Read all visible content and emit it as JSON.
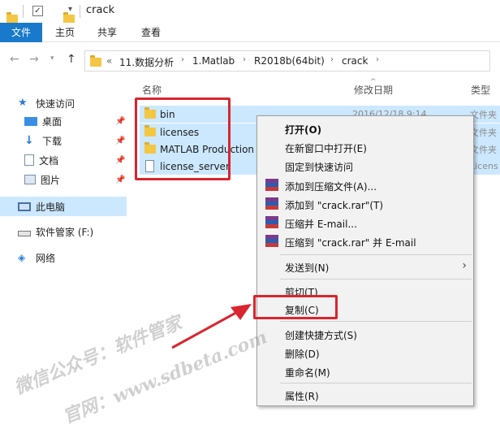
{
  "window": {
    "title": "crack"
  },
  "ribbon": {
    "tabs": [
      "文件",
      "主页",
      "共享",
      "查看"
    ]
  },
  "address": {
    "overflow": "«",
    "segments": [
      "11.数据分析",
      "1.Matlab",
      "R2018b(64bit)",
      "crack"
    ]
  },
  "navpane": {
    "quick_access": "快速访问",
    "items": [
      "桌面",
      "下载",
      "文档",
      "图片"
    ],
    "this_pc": "此电脑",
    "drive": "软件管家 (F:)",
    "network": "网络"
  },
  "columns": {
    "name": "名称",
    "date": "修改日期",
    "type": "类型"
  },
  "files": [
    {
      "name": "bin",
      "date": "2016/12/18 9:14",
      "type": "文件夹",
      "icon": "folder-icon"
    },
    {
      "name": "licenses",
      "date": "",
      "type": "文件夹",
      "icon": "folder-icon"
    },
    {
      "name": "MATLAB Production",
      "date": "",
      "type": "文件夹",
      "icon": "folder-icon"
    },
    {
      "name": "license_server",
      "date": "",
      "type": "Licens",
      "icon": "document-icon"
    }
  ],
  "context_menu": {
    "open": "打开(O)",
    "open_new_window": "在新窗口中打开(E)",
    "pin_quick_access": "固定到快速访问",
    "add_archive": "添加到压缩文件(A)...",
    "add_crack_rar": "添加到 \"crack.rar\"(T)",
    "compress_email": "压缩并 E-mail...",
    "compress_crack_email": "压缩到 \"crack.rar\" 并 E-mail",
    "send_to": "发送到(N)",
    "cut": "剪切(T)",
    "copy": "复制(C)",
    "create_shortcut": "创建快捷方式(S)",
    "delete": "删除(D)",
    "rename": "重命名(M)",
    "properties": "属性(R)"
  },
  "watermark": {
    "line1": "微信公众号：软件管家",
    "line2": "官网：www.sdbeta.com"
  },
  "colors": {
    "accent": "#1979ca",
    "selection": "#cce8ff",
    "highlight_red": "#d9252f",
    "folder": "#f3c644"
  }
}
